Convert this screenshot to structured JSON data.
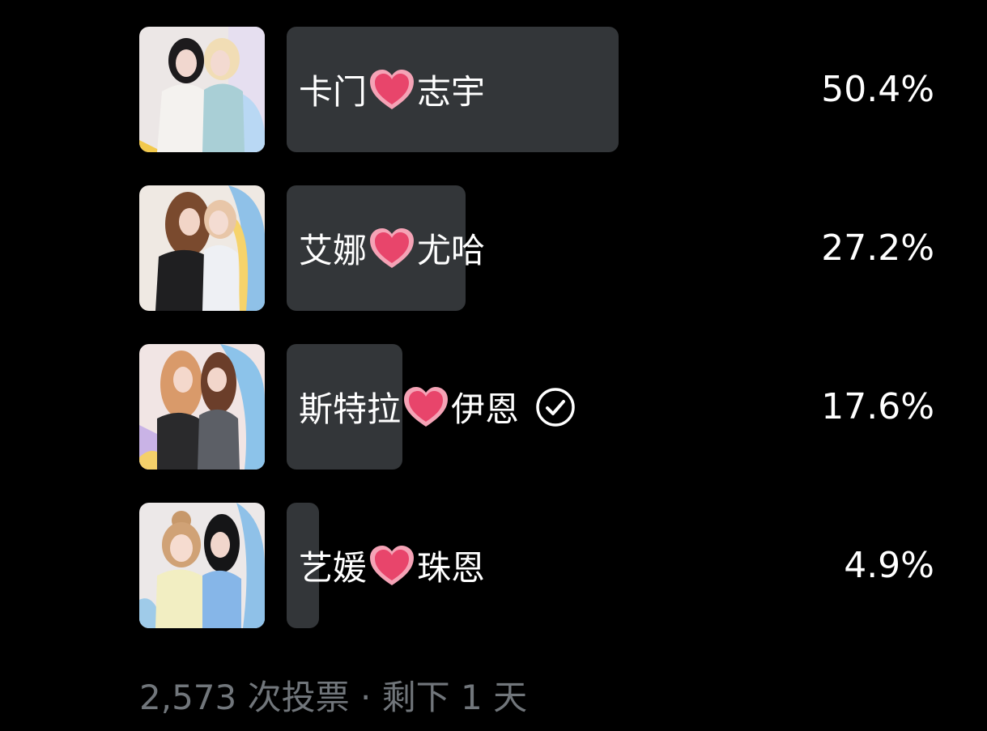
{
  "poll": {
    "options": [
      {
        "left": "卡门",
        "right": "志宇",
        "percent_text": "50.4%",
        "percent": 50.4,
        "selected": false
      },
      {
        "left": "艾娜",
        "right": "尤哈",
        "percent_text": "27.2%",
        "percent": 27.2,
        "selected": false
      },
      {
        "left": "斯特拉",
        "right": "伊恩",
        "percent_text": "17.6%",
        "percent": 17.6,
        "selected": true
      },
      {
        "left": "艺媛",
        "right": "珠恩",
        "percent_text": "4.9%",
        "percent": 4.9,
        "selected": false
      }
    ],
    "footer": "2,573 次投票 · 剩下 1 天"
  },
  "colors": {
    "background": "#000000",
    "bar": "#333639",
    "text": "#ffffff",
    "muted": "#71767b",
    "heart": "#e8456b"
  },
  "icons": [
    "heart-icon",
    "check-circle-icon"
  ]
}
